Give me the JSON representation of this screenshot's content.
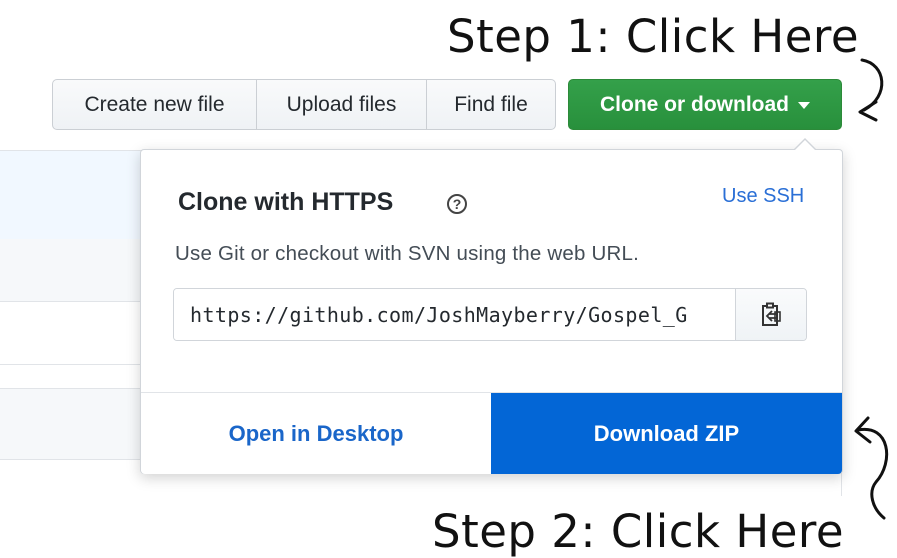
{
  "annotations": {
    "step1": "Step 1: Click Here",
    "step2": "Step 2: Click Here"
  },
  "toolbar": {
    "create_label": "Create new file",
    "upload_label": "Upload files",
    "find_label": "Find file",
    "clone_label": "Clone or download"
  },
  "clone_panel": {
    "title": "Clone with HTTPS",
    "help_glyph": "?",
    "use_ssh": "Use SSH",
    "description": "Use Git or checkout with SVN using the web URL.",
    "url": "https://github.com/JoshMayberry/Gospel_G",
    "open_desktop": "Open in Desktop",
    "download_zip": "Download ZIP"
  },
  "icons": {
    "help": "question-circle-icon",
    "copy": "clipboard-icon",
    "caret": "caret-down-icon",
    "arrow1": "curved-arrow-icon",
    "arrow2": "curved-arrow-icon"
  },
  "colors": {
    "clone_green": "#2ea44f",
    "download_blue": "#0366d6",
    "link_blue": "#1a66c9"
  }
}
